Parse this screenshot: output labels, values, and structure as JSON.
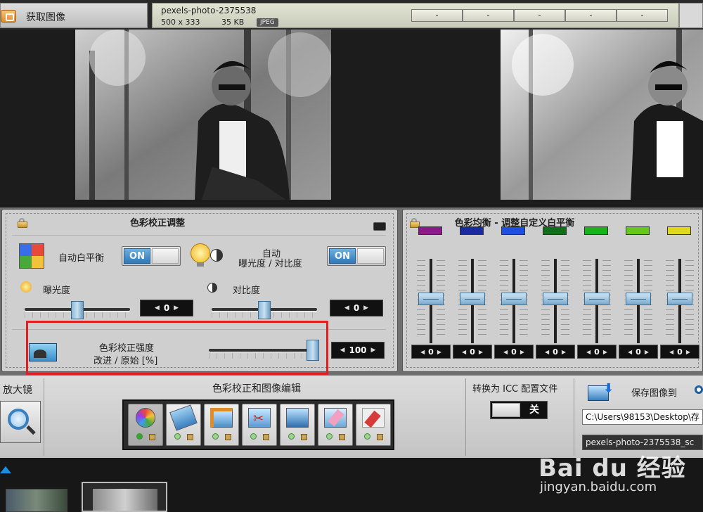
{
  "toolbar": {
    "acquire_label": "获取图像",
    "file_name": "pexels-photo-2375538",
    "dimensions": "500 x 333",
    "file_size": "35 KB",
    "format_badge": "JPEG",
    "slots": [
      "-",
      "-",
      "-",
      "-",
      "-"
    ]
  },
  "color_correction": {
    "title": "色彩校正调整",
    "auto_wb_label": "自动白平衡",
    "auto_wb_toggle": "ON",
    "auto_exposure_label_1": "自动",
    "auto_exposure_label_2": "曝光度 / 对比度",
    "auto_exposure_toggle": "ON",
    "exposure_label": "曝光度",
    "exposure_value": "0",
    "exposure_level": 0.5,
    "contrast_label": "对比度",
    "contrast_value": "0",
    "contrast_level": 0.5,
    "strength_label_1": "色彩校正强度",
    "strength_label_2": "改进 / 原始 [%]",
    "strength_value": "100",
    "strength_level": 1.0
  },
  "color_balance": {
    "title": "色彩均衡 - 调整自定义白平衡",
    "channels": [
      {
        "color": "#8a1a8a",
        "value": "0",
        "level": 0.5
      },
      {
        "color": "#1a2aa0",
        "value": "0",
        "level": 0.5
      },
      {
        "color": "#1f4fe0",
        "value": "0",
        "level": 0.5
      },
      {
        "color": "#0f6e1a",
        "value": "0",
        "level": 0.5
      },
      {
        "color": "#18b21a",
        "value": "0",
        "level": 0.5
      },
      {
        "color": "#66c81a",
        "value": "0",
        "level": 0.5
      },
      {
        "color": "#e0d81a",
        "value": "0",
        "level": 0.5
      }
    ]
  },
  "bottom": {
    "magnifier_label": "放大镜",
    "edit_label": "色彩校正和图像编辑",
    "icc_label": "转换为 ICC 配置文件",
    "icc_toggle": "关",
    "save_label": "保存图像到",
    "save_path": "C:\\Users\\98153\\Desktop\\存",
    "save_name": "pexels-photo-2375538_sc"
  },
  "watermark": {
    "brand": "Bai du 经验",
    "url": "jingyan.baidu.com"
  }
}
